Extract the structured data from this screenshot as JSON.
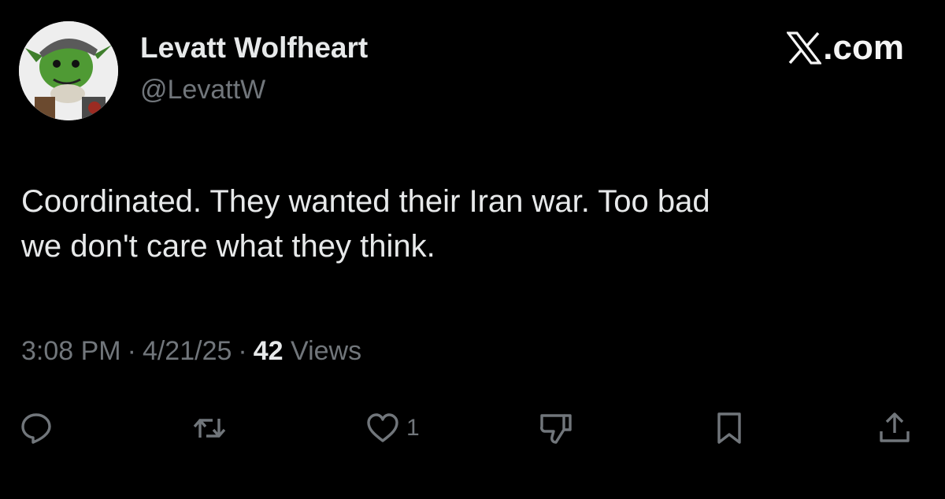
{
  "header": {
    "display_name": "Levatt Wolfheart",
    "handle": "@LevattW",
    "brand": ".com"
  },
  "post": {
    "text_line1": "Coordinated. They wanted their Iran war. Too bad",
    "text_line2": "we don't care what they think."
  },
  "meta": {
    "time": "3:08 PM",
    "date": "4/21/25",
    "separator": "·",
    "views_count": "42",
    "views_label": "Views"
  },
  "actions": {
    "reply_icon": "reply-icon",
    "repost_icon": "repost-icon",
    "like_icon": "heart-icon",
    "like_count": "1",
    "dislike_icon": "thumbs-down-icon",
    "bookmark_icon": "bookmark-icon",
    "share_icon": "share-icon"
  },
  "colors": {
    "background": "#000000",
    "primary_text": "#e7e9ea",
    "secondary_text": "#71767b"
  }
}
